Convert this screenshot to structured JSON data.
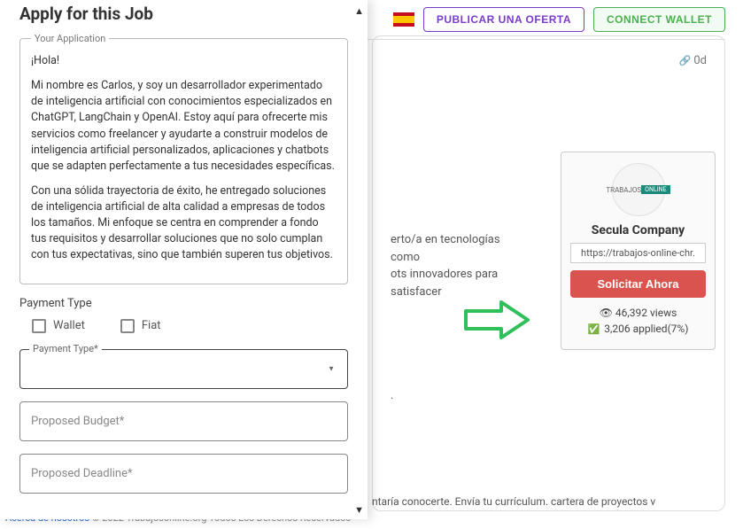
{
  "header": {
    "post_job": "PUBLICAR UNA OFERTA",
    "connect_wallet": "CONNECT WALLET"
  },
  "job": {
    "time_badge": "0d",
    "desc_frag1": "erto/a en tecnologías como",
    "desc_frag2": "ots innovadores para satisfacer",
    "desc_frag3": ".",
    "bottom_text": "ntaría conocerte. Envía tu currículum. cartera de proyectos v"
  },
  "company": {
    "avatar_label_left": "TRABAJOS",
    "avatar_label_right": "ONLINE",
    "name": "Secula Company",
    "url": "https://trabajos-online-chr.",
    "apply_btn": "Solicitar Ahora",
    "views_count": "46,392",
    "views_label": "views",
    "applied_count": "3,206",
    "applied_label": "applied",
    "applied_pct": "(7%)"
  },
  "footer": {
    "about": "Acerca de nosotros",
    "copyright": "© 2022 Trabajosonline.org Todos Los Derechos Reservados"
  },
  "modal": {
    "title": "Apply for this Job",
    "legend": "Your Application",
    "para1": "¡Hola!",
    "para2": "Mi nombre es Carlos, y soy un desarrollador experimentado de inteligencia artificial con conocimientos especializados en ChatGPT, LangChain y OpenAI. Estoy aquí para ofrecerte mis servicios como freelancer y ayudarte a construir modelos de inteligencia artificial personalizados, aplicaciones y chatbots que se adapten perfectamente a tus necesidades específicas.",
    "para3": "Con una sólida trayectoria de éxito, he entregado soluciones de inteligencia artificial de alta calidad a empresas de todos los tamaños. Mi enfoque se centra en comprender a fondo tus requisitos y desarrollar soluciones que no solo cumplan con tus expectativas, sino que también superen tus objetivos.",
    "payment_type_label": "Payment Type",
    "cb_wallet": "Wallet",
    "cb_fiat": "Fiat",
    "field_payment_type": "Payment Type*",
    "field_budget": "Proposed Budget*",
    "field_deadline": "Proposed Deadline*"
  }
}
